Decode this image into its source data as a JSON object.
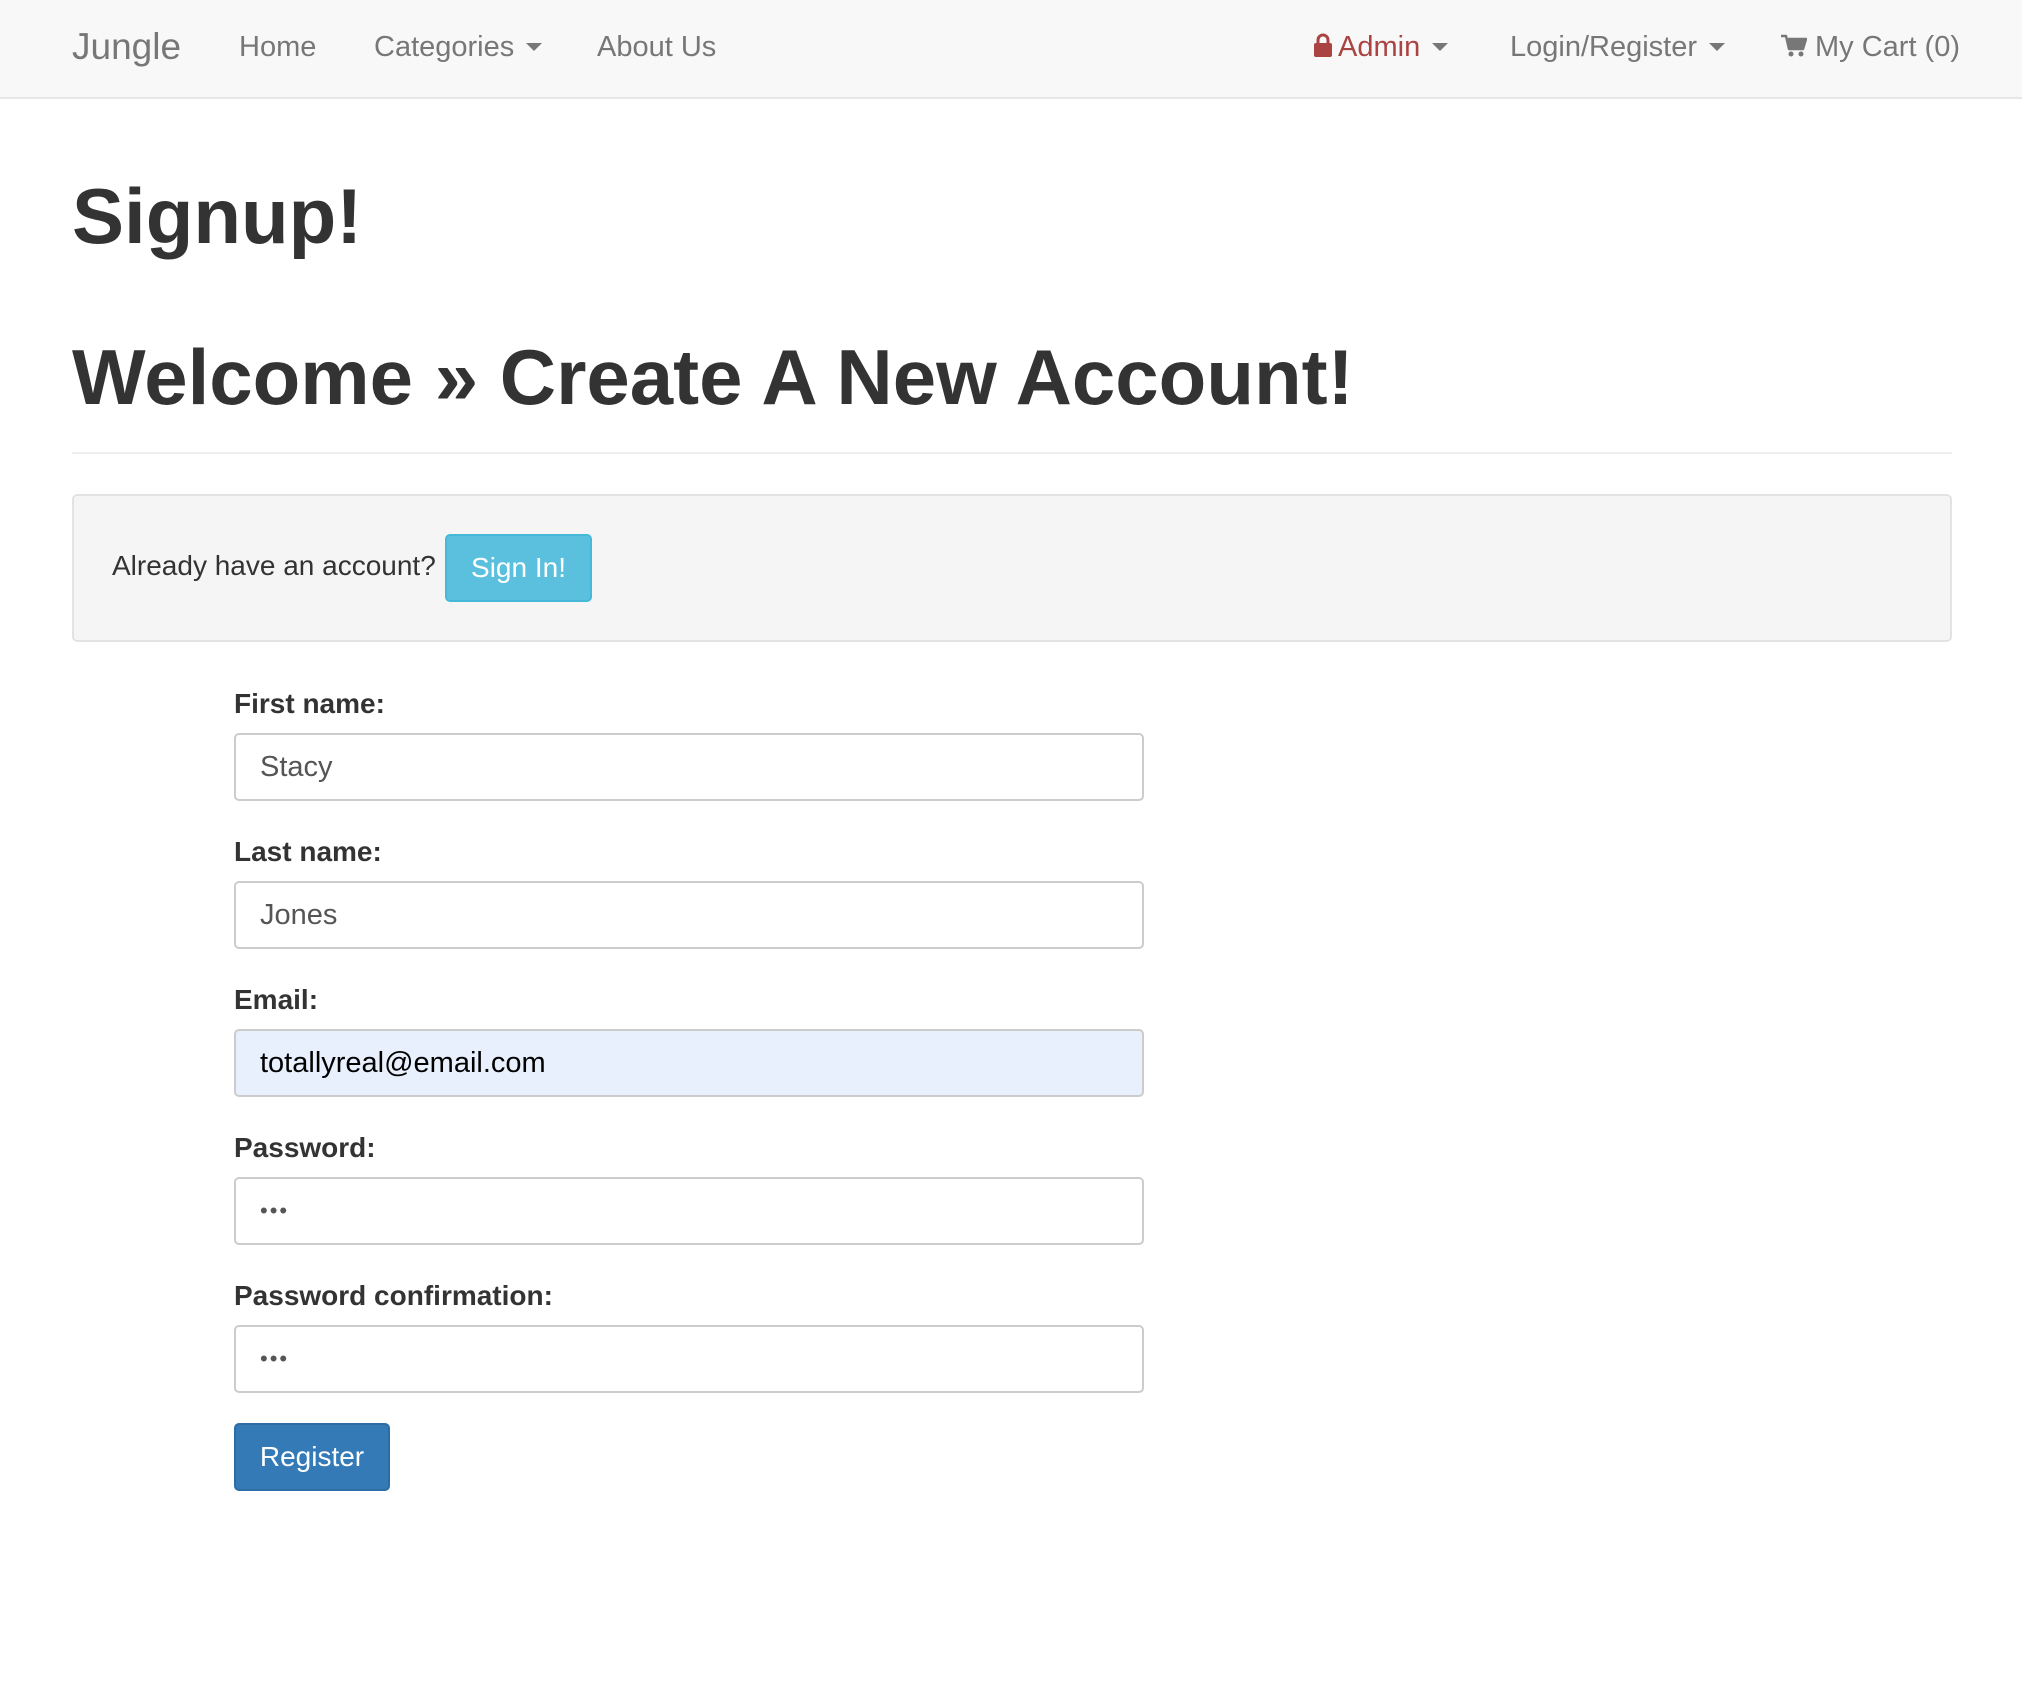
{
  "navbar": {
    "brand": "Jungle",
    "home": "Home",
    "categories": "Categories",
    "about": "About Us",
    "admin": "Admin",
    "login_register": "Login/Register",
    "cart": "My Cart (0)",
    "icons": [
      "lock-icon",
      "cart-icon",
      "caret-down-icon"
    ],
    "colors": {
      "admin_text": "#a94442",
      "navbar_bg": "#f8f8f8"
    }
  },
  "page": {
    "title": "Signup!",
    "heading": "Welcome » Create A New Account!"
  },
  "signin_prompt": {
    "text": "Already have an account?",
    "button": "Sign In!",
    "button_color": "#5bc0de"
  },
  "form": {
    "first_name": {
      "label": "First name:",
      "value": "Stacy"
    },
    "last_name": {
      "label": "Last name:",
      "value": "Jones"
    },
    "email": {
      "label": "Email:",
      "value": "totallyreal@email.com"
    },
    "password": {
      "label": "Password:",
      "value": "•••"
    },
    "password_confirmation": {
      "label": "Password confirmation:",
      "value": "•••"
    },
    "submit": "Register",
    "submit_color": "#337ab7"
  }
}
